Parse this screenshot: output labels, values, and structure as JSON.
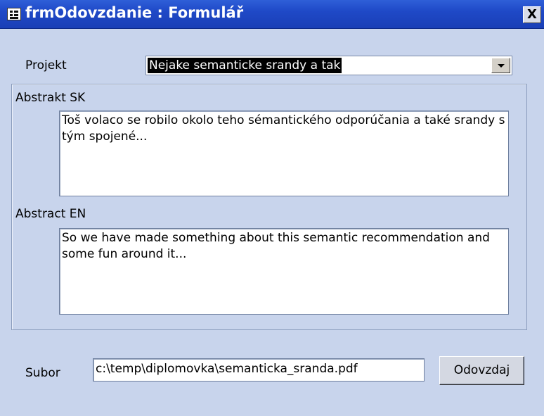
{
  "window": {
    "title": "frmOdovzdanie : Formulář",
    "close_label": "X"
  },
  "projekt": {
    "label": "Projekt",
    "value": "Nejake semanticke srandy a tak"
  },
  "abstract_sk": {
    "label": "Abstrakt SK",
    "value": "Toš volaco se robilo okolo teho sémantického odporúčania a také srandy s tým spojené..."
  },
  "abstract_en": {
    "label": "Abstract EN",
    "value": "So we have made something about this semantic recommendation and some fun around it..."
  },
  "subor": {
    "label": "Subor",
    "value": "c:\\temp\\diplomovka\\semanticka_sranda.pdf"
  },
  "submit": {
    "label": "Odovzdaj"
  },
  "colors": {
    "titlebar": "#1f49c7",
    "form_background": "#c8d4ec"
  }
}
